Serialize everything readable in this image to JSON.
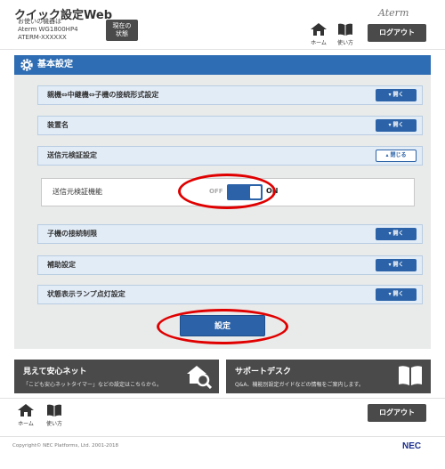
{
  "header": {
    "title": "クイック設定Web",
    "device_label": "お使いの機器は",
    "model": "Aterm WG1800HP4",
    "device_id": "ATERM-XXXXXX",
    "status_button": [
      "現在の",
      "状態"
    ],
    "brand": "Aterm",
    "home_label": "ホーム",
    "help_label": "使い方",
    "logout_label": "ログアウト"
  },
  "panel": {
    "title": "基本設定",
    "open_label": "開く",
    "close_label": "閉じる",
    "sections": [
      {
        "label": "親機⇔中継機⇔子機の接続形式設定",
        "state": "closed"
      },
      {
        "label": "装置名",
        "state": "closed"
      },
      {
        "label": "送信元検証設定",
        "state": "open"
      },
      {
        "label": "子機の接続制限",
        "state": "closed"
      },
      {
        "label": "補助設定",
        "state": "closed"
      },
      {
        "label": "状態表示ランプ点灯設定",
        "state": "closed"
      }
    ],
    "source_check": {
      "label": "送信元検証機能",
      "off_label": "OFF",
      "on_label": "ON",
      "value": "ON"
    },
    "submit_label": "設定"
  },
  "banners": [
    {
      "title": "見えて安心ネット",
      "desc": "「こども安心ネットタイマー」などの設定はこちらから。",
      "icon": "house-magnifier-icon"
    },
    {
      "title": "サポートデスク",
      "desc": "Q&A、機能別設定ガイドなどの情報をご案内します。",
      "icon": "book-icon"
    }
  ],
  "footer": {
    "home_label": "ホーム",
    "help_label": "使い方",
    "logout_label": "ログアウト",
    "copyright": "Copyright© NEC Platforms, Ltd. 2001-2018",
    "logo": "NEC"
  },
  "colors": {
    "primary": "#2c63a8",
    "header_blue": "#2e6db3",
    "dark_button": "#4a4a4a",
    "highlight": "#e00000"
  }
}
